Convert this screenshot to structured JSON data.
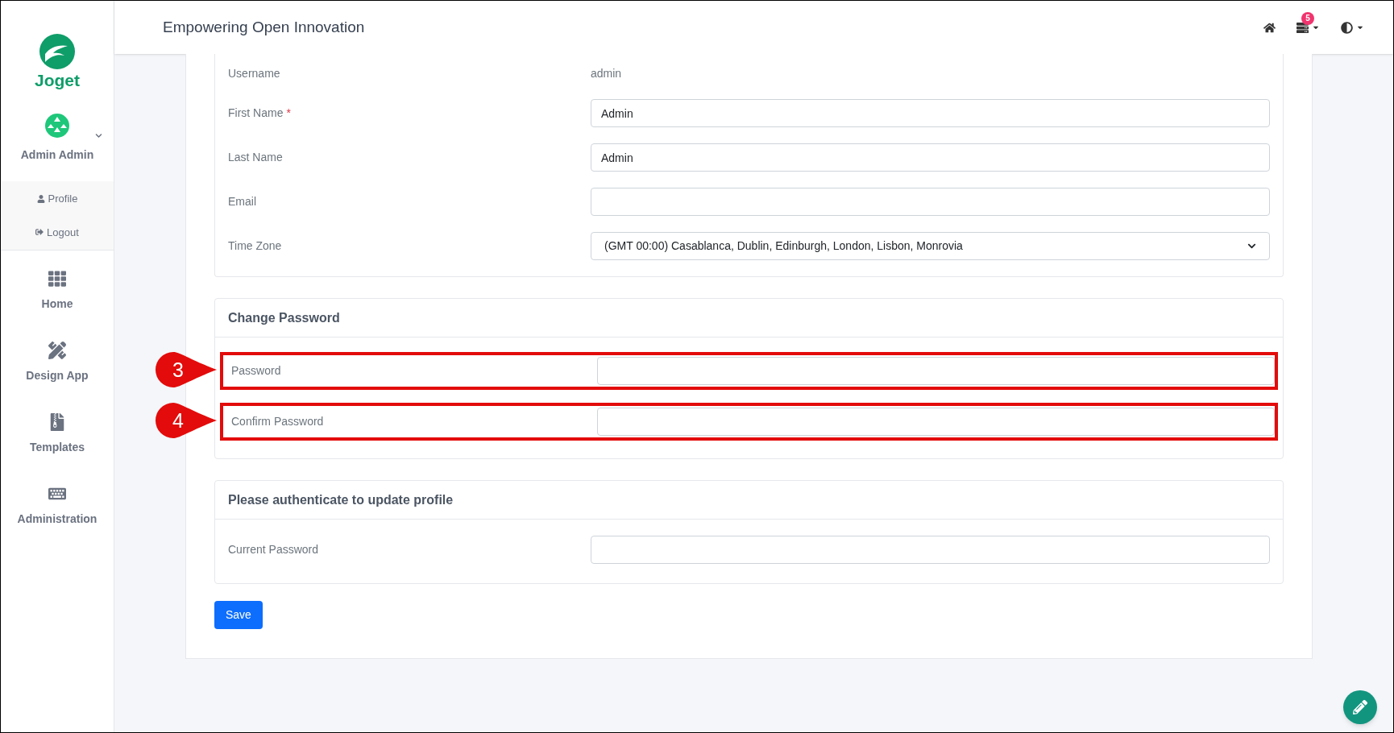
{
  "sidebar": {
    "logo": "Joget",
    "user": {
      "name": "Admin Admin",
      "expanded": true,
      "menu": [
        {
          "label": "Profile"
        },
        {
          "label": "Logout"
        }
      ]
    },
    "items": [
      {
        "label": "Home"
      },
      {
        "label": "Design App"
      },
      {
        "label": "Templates"
      },
      {
        "label": "Administration"
      }
    ]
  },
  "header": {
    "title": "Empowering Open Innovation",
    "notification_count": "5"
  },
  "sections": [
    {
      "fields": [
        {
          "kind": "static",
          "label": "Username",
          "value": "admin"
        },
        {
          "kind": "text",
          "label": "First Name",
          "required_mark": "*",
          "value": "Admin"
        },
        {
          "kind": "text",
          "label": "Last Name",
          "value": "Admin"
        },
        {
          "kind": "text",
          "label": "Email"
        },
        {
          "kind": "select",
          "label": "Time Zone",
          "value": "(GMT 00:00) Casablanca, Dublin, Edinburgh, London, Lisbon, Monrovia"
        }
      ]
    },
    {
      "title": "Change Password",
      "fields": [
        {
          "kind": "password",
          "label": "Password",
          "callout": "3"
        },
        {
          "kind": "password",
          "label": "Confirm Password",
          "callout": "4"
        }
      ]
    },
    {
      "title": "Please authenticate to update profile",
      "fields": [
        {
          "kind": "password",
          "label": "Current Password"
        }
      ]
    }
  ],
  "save_button": "Save"
}
